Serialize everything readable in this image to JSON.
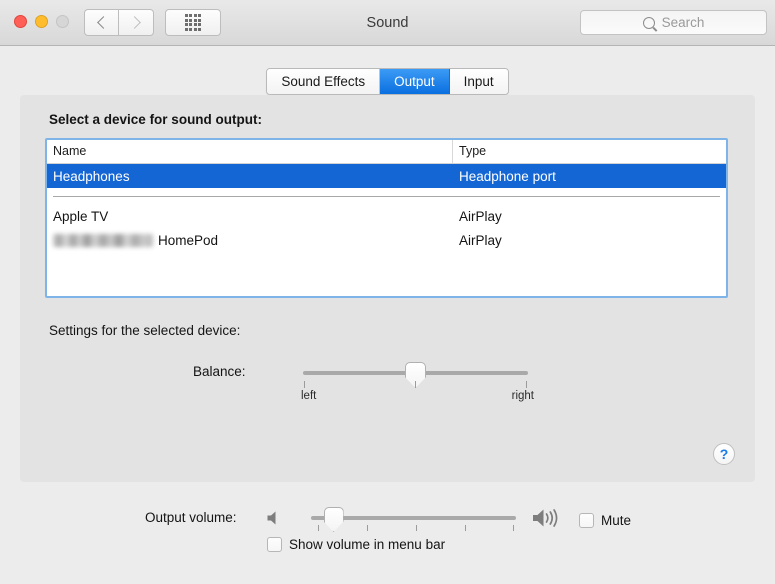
{
  "window": {
    "title": "Sound",
    "traffic_lights": [
      {
        "name": "close",
        "color": "#ff5f57"
      },
      {
        "name": "minimize",
        "color": "#ffbd2e"
      },
      {
        "name": "zoom",
        "color": "#d6d6d6"
      }
    ],
    "nav": {
      "back_icon": "chevron-left-icon",
      "forward_icon": "chevron-right-icon"
    },
    "grid_icon": "show-all-grid-icon",
    "search": {
      "placeholder": "Search",
      "value": "",
      "icon": "search-icon"
    }
  },
  "tabs": [
    {
      "label": "Sound Effects",
      "active": false
    },
    {
      "label": "Output",
      "active": true
    },
    {
      "label": "Input",
      "active": false
    }
  ],
  "output_pane": {
    "section_title": "Select a device for sound output:",
    "table": {
      "columns": [
        "Name",
        "Type"
      ],
      "rows": [
        {
          "name": "Headphones",
          "type": "Headphone port",
          "selected": true,
          "redacted": false
        },
        {
          "name": "Apple TV",
          "type": "AirPlay",
          "selected": false,
          "redacted": false
        },
        {
          "name": "HomePod",
          "type": "AirPlay",
          "selected": false,
          "redacted": true
        }
      ]
    },
    "settings_title": "Settings for the selected device:",
    "balance": {
      "label": "Balance:",
      "left_caption": "left",
      "right_caption": "right",
      "value_percent": 50
    },
    "help_button": {
      "icon": "question-mark-icon",
      "label": "?"
    }
  },
  "bottom": {
    "output_volume_label": "Output volume:",
    "volume_low_icon": "speaker-mute-icon",
    "volume_high_icon": "speaker-waves-icon",
    "volume_percent": 11,
    "mute": {
      "label": "Mute",
      "checked": false
    },
    "show_in_menu_bar": {
      "label": "Show volume in menu bar",
      "checked": false
    }
  },
  "colors": {
    "accent_blue": "#1466d4",
    "tab_active_blue": "#0a6fe0",
    "focus_ring": "#7fb4e8",
    "window_bg": "#ececec",
    "panel_bg": "#e3e3e3",
    "help_blue": "#1a7bea"
  }
}
